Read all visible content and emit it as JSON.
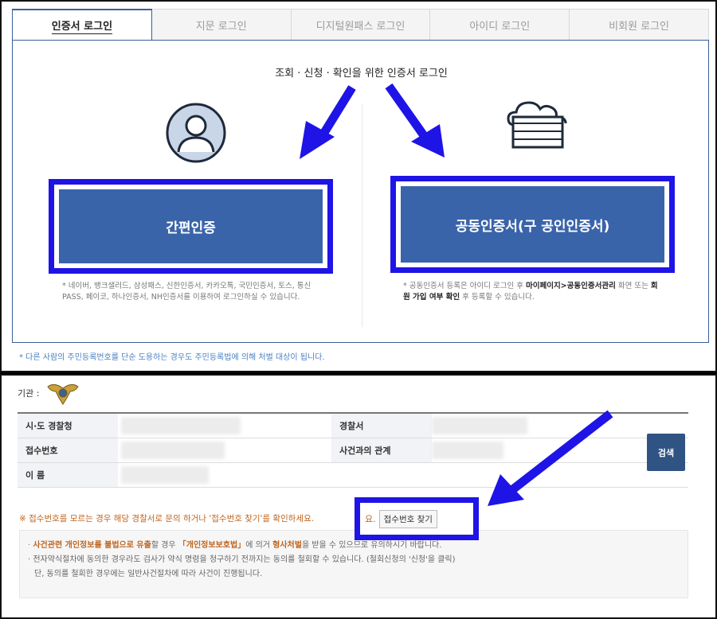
{
  "tabs": [
    {
      "label": "인증서 로그인",
      "active": true
    },
    {
      "label": "지문 로그인",
      "active": false
    },
    {
      "label": "디지털원패스 로그인",
      "active": false
    },
    {
      "label": "아이디 로그인",
      "active": false
    },
    {
      "label": "비회원 로그인",
      "active": false
    }
  ],
  "login": {
    "heading": "조회 · 신청 · 확인을 위한 인증서 로그인",
    "simple_auth_label": "간편인증",
    "joint_cert_label": "공동인증서(구 공인인증서)",
    "simple_note": "* 네이버, 뱅크샐러드, 삼성패스, 신한인증서, 카카오톡, 국민인증서, 토스, 통신PASS, 페이코, 하나인증서, NH인증서를 이용하여 로그인하실 수 있습니다.",
    "joint_note_a": "* 공동인증서 등록은 아이디 로그인 후 ",
    "joint_note_b": "마이페이지>공동인증서관리",
    "joint_note_c": " 화면 또는 ",
    "joint_note_d": "회원 가입 여부 확인",
    "joint_note_e": " 후 등록할 수 있습니다.",
    "footnote": "* 다른 사람의 주민등록번호를 단순 도용하는 경우도 주민등록법에 의해 처벌 대상이 됩니다."
  },
  "lookup": {
    "institution_label": "기관 :",
    "rows": [
      {
        "left_label": "시·도 경찰청",
        "right_label": "경찰서"
      },
      {
        "left_label": "접수번호",
        "right_label": "사건과의 관계"
      },
      {
        "left_label": "이 름",
        "right_label": ""
      }
    ],
    "search_label": "검색",
    "warning": "※ 접수번호를 모르는 경우 해당 경찰서로 문의 하거나 '접수번호 찾기'를 확인하세요.",
    "find_prefix": "요.",
    "find_button_label": "접수번호 찾기",
    "info_1a": "· ",
    "info_1b": "사건관련 개인정보를 불법으로 유출",
    "info_1c": "할 경우 ",
    "info_1d": "「개인정보보호법」",
    "info_1e": "에 의거 ",
    "info_1f": "형사처벌",
    "info_1g": "을 받을 수 있으므로 유의하시기 바랍니다.",
    "info_2": "· 전자약식절차에 동의한 경우라도 검사가 약식 명령을 청구하기 전까지는 동의를 철회할 수 있습니다. (철회신청의 '신청'을 클릭)",
    "info_3": "단, 동의를 철회한 경우에는 일반사건절차에 따라 사건이 진행됩니다."
  },
  "colors": {
    "accent_blue": "#1f14e6",
    "button_blue": "#3a64aa",
    "warning_orange": "#c0651f",
    "link_blue": "#4a7fc4"
  }
}
